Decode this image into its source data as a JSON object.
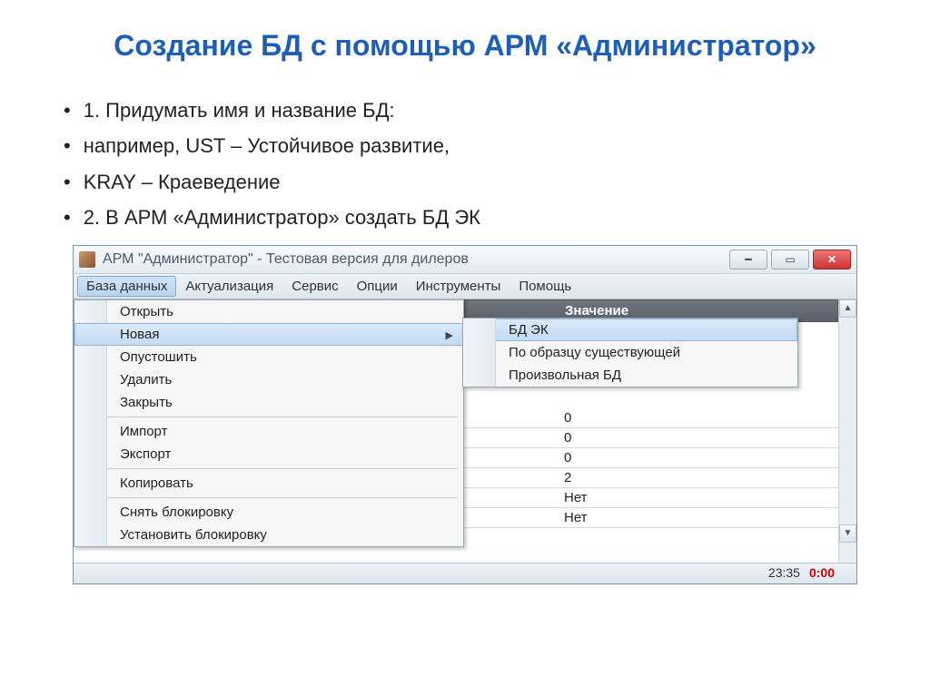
{
  "slide": {
    "title": "Создание БД с помощью АРМ «Администратор»",
    "bullets": [
      "1. Придумать имя и название БД:",
      "например, UST – Устойчивое развитие,",
      "KRAY – Краеведение",
      "2. В АРМ «Администратор» создать БД ЭК"
    ]
  },
  "window": {
    "title": "АРМ \"Администратор\" - Тестовая версия для дилеров",
    "menubar": [
      "База данных",
      "Актуализация",
      "Сервис",
      "Опции",
      "Инструменты",
      "Помощь"
    ],
    "column_header": "Значение",
    "dropdown": {
      "items": [
        {
          "label": "Открыть"
        },
        {
          "label": "Новая",
          "submenu": true
        },
        {
          "label": "Опустошить"
        },
        {
          "label": "Удалить"
        },
        {
          "label": "Закрыть"
        },
        {
          "sep": true
        },
        {
          "label": "Импорт"
        },
        {
          "label": "Экспорт"
        },
        {
          "sep": true
        },
        {
          "label": "Копировать"
        },
        {
          "sep": true
        },
        {
          "label": "Снять блокировку"
        },
        {
          "label": "Установить блокировку"
        }
      ]
    },
    "submenu": {
      "items": [
        "БД ЭК",
        "По образцу существующей",
        "Произвольная БД"
      ]
    },
    "grid_values": [
      "0",
      "0",
      "0",
      "2",
      "Нет",
      "Нет"
    ],
    "status": {
      "time": "23:35",
      "extra": "0:00"
    }
  }
}
